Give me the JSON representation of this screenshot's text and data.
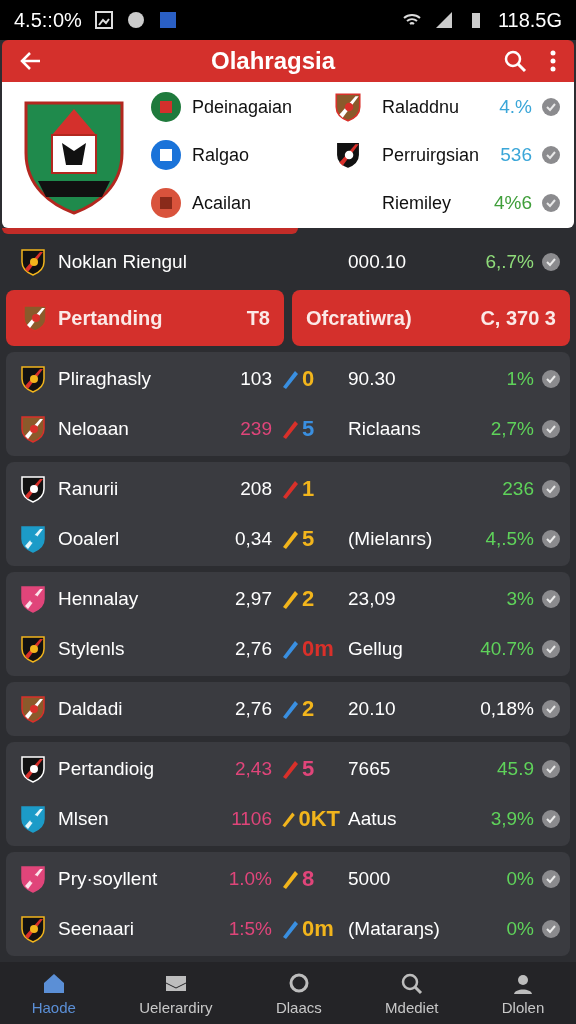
{
  "status_bar": {
    "time": "4.5::0%",
    "right": "118.5G"
  },
  "header": {
    "title": "Olahragsia"
  },
  "top_card": {
    "rows": [
      {
        "left": "Pdeinagaian",
        "right": "Raladdnu",
        "pct": "4.%",
        "color": "#3aa6d8"
      },
      {
        "left": "Ralgao",
        "right": "Perruirgsian",
        "pct": "536",
        "color": "#3aa6d8"
      },
      {
        "left": "Acailan",
        "right": "Riemiley",
        "pct": "4%6",
        "color": "#3f9e3a"
      }
    ]
  },
  "summary": {
    "name": "Noklan Riengul",
    "value": "000.10",
    "pct": "6,.7%"
  },
  "highlights": [
    {
      "label": "Pertanding",
      "value": "T8"
    },
    {
      "label": "Ofcratiwra)",
      "value": "C, 370 3"
    }
  ],
  "groups": [
    {
      "rows": [
        {
          "name": "Pliraghasly",
          "value": {
            "text": "103",
            "color": "#ffffff"
          },
          "score": {
            "text": "0",
            "color": "#f2b51c"
          },
          "text": "90.30",
          "pct": {
            "text": "1%",
            "color": "#5fd35a"
          }
        },
        {
          "name": "Neloaan",
          "value": {
            "text": "239",
            "color": "#e0457a"
          },
          "score": {
            "text": "5",
            "color": "#3a8fe0"
          },
          "text": "Riclaans",
          "pct": {
            "text": "2,7%",
            "color": "#5fd35a"
          }
        }
      ]
    },
    {
      "rows": [
        {
          "name": "Ranurii",
          "value": {
            "text": "208",
            "color": "#ffffff"
          },
          "score": {
            "text": "1",
            "color": "#f2b51c"
          },
          "pct": {
            "text": "236",
            "color": "#5fd35a"
          }
        },
        {
          "name": "Ooalerl",
          "value": {
            "text": "0,34",
            "color": "#ffffff"
          },
          "score": {
            "text": "5",
            "color": "#f2b51c"
          },
          "text": "(Mielanrs)",
          "pct": {
            "text": "4,.5%",
            "color": "#5fd35a"
          }
        }
      ]
    },
    {
      "rows": [
        {
          "name": "Hennalay",
          "value": {
            "text": "2,97",
            "color": "#ffffff"
          },
          "score": {
            "text": "2",
            "color": "#f2b51c"
          },
          "text": "23,09",
          "pct": {
            "text": "3%",
            "color": "#5fd35a"
          }
        },
        {
          "name": "Stylenls",
          "value": {
            "text": "2,76",
            "color": "#ffffff"
          },
          "score": {
            "text": "0m",
            "color": "#d9302a"
          },
          "text": "Gellug",
          "pct": {
            "text": "40.7%",
            "color": "#5fd35a"
          }
        }
      ]
    },
    {
      "rows": [
        {
          "name": "Daldadi",
          "value": {
            "text": "2,76",
            "color": "#ffffff"
          },
          "score": {
            "text": "2",
            "color": "#f2b51c"
          },
          "text": "20.10",
          "pct": {
            "text": "0,18%",
            "color": "#ffffff"
          }
        }
      ]
    },
    {
      "rows": [
        {
          "name": "Pertandioig",
          "value": {
            "text": "2,43",
            "color": "#e0457a"
          },
          "score": {
            "text": "5",
            "color": "#e0457a"
          },
          "text": "7665",
          "pct": {
            "text": "45.9",
            "color": "#5fd35a"
          }
        },
        {
          "name": "Mlsen",
          "value": {
            "text": "1106",
            "color": "#e0457a"
          },
          "score": {
            "text": "0KT",
            "color": "#f2b51c"
          },
          "text": "Aatus",
          "pct": {
            "text": "3,9%",
            "color": "#5fd35a"
          }
        }
      ]
    },
    {
      "rows": [
        {
          "name": "Pry·soyllent",
          "value": {
            "text": "1.0%",
            "color": "#e0457a"
          },
          "score": {
            "text": "8",
            "color": "#e0457a"
          },
          "text": "5000",
          "pct": {
            "text": "0%",
            "color": "#5fd35a"
          }
        },
        {
          "name": "Seenaari",
          "value": {
            "text": "1:5%",
            "color": "#e0457a"
          },
          "score": {
            "text": "0m",
            "color": "#f2b51c"
          },
          "text": "(Mataraŋs)",
          "pct": {
            "text": "0%",
            "color": "#5fd35a"
          }
        }
      ]
    }
  ],
  "nav": [
    {
      "label": "Haode",
      "selected": true
    },
    {
      "label": "Uelerardiry",
      "selected": false
    },
    {
      "label": "Dlaacs",
      "selected": false
    },
    {
      "label": "Mdediet",
      "selected": false
    },
    {
      "label": "Dlolen",
      "selected": false
    }
  ]
}
